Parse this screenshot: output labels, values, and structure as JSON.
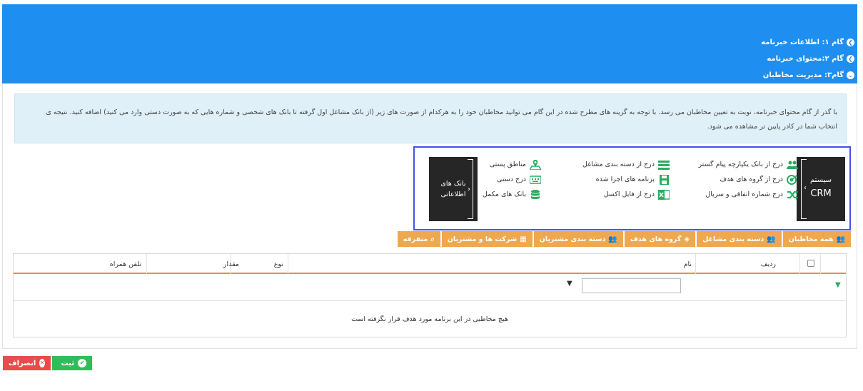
{
  "steps": [
    {
      "label": "گام ۱: اطلاعات خبرنامه",
      "icon": "chevron-right-circle-icon"
    },
    {
      "label": "گام ۲:محتوای خبرنامه",
      "icon": "chevron-right-circle-icon"
    },
    {
      "label": "گام۳: مدیریت مخاطبان",
      "icon": "chevron-down-circle-icon"
    }
  ],
  "info": {
    "line1": "با گذر از گام محتوای خبرنامه، نوبت به تعیین مخاطبان می رسد. با توجه به گزینه های مطرح شده در این گام می توانید مخاطبان خود را به هرکدام از صورت های زیر (از بانک مشاغل اول گرفته تا بانک های شخصی و شماره هایی که به صورت دستی وارد می کنید) اضافه کنید. نتیجه ی",
    "line2": "انتخاب شما در کادر پایین تر مشاهده می شود."
  },
  "crm": {
    "line1": "سیستم",
    "line2": "CRM"
  },
  "banks": {
    "line1": "بانک های",
    "line2": "اطلاعاتی"
  },
  "sources": {
    "col1": [
      {
        "label": "درج از بانک یکپارچه پیام گستر",
        "icon": "users-icon"
      },
      {
        "label": "درج از گروه های هدف",
        "icon": "target-icon"
      },
      {
        "label": "درج شماره اتفاقی و سریال",
        "icon": "shuffle-icon"
      }
    ],
    "col2": [
      {
        "label": "درج از دسته بندی مشاغل",
        "icon": "list-icon"
      },
      {
        "label": "برنامه های اجرا شده",
        "icon": "floppy-icon"
      },
      {
        "label": "درج از فایل اکسل",
        "icon": "excel-icon"
      }
    ],
    "col3": [
      {
        "label": "مناطق پستی",
        "icon": "map-marker-icon"
      },
      {
        "label": "درج دستی",
        "icon": "keyboard-icon"
      },
      {
        "label": "بانک های مکمل",
        "icon": "database-icon"
      }
    ]
  },
  "tabs": [
    {
      "label": "همه مخاطبان",
      "icon": "users-icon"
    },
    {
      "label": "دسته بندی مشاغل",
      "icon": "users-icon"
    },
    {
      "label": "گروه های هدف",
      "icon": "target-icon"
    },
    {
      "label": "دسته بندی مشتریان",
      "icon": "users-icon"
    },
    {
      "label": "شرکت ها و مشتریان",
      "icon": "building-icon"
    },
    {
      "label": "متفرقه",
      "icon": "search-icon"
    }
  ],
  "grid": {
    "columns": {
      "row": "ردیف",
      "name": "نام",
      "type": "نوع",
      "amount": "مقدار",
      "mobile": "تلفن همراه"
    },
    "name_filter_value": "",
    "empty_text": "هیچ مخاطبی در این برنامه مورد هدف قرار نگرفته است"
  },
  "buttons": {
    "save": "ثبت",
    "cancel": "انصراف"
  },
  "colors": {
    "header": "#1e8ff0",
    "tab": "#f0a84e",
    "save": "#2fbd5a",
    "cancel": "#e84c4c",
    "icon": "#27ae60",
    "highlight": "#4452e8"
  }
}
